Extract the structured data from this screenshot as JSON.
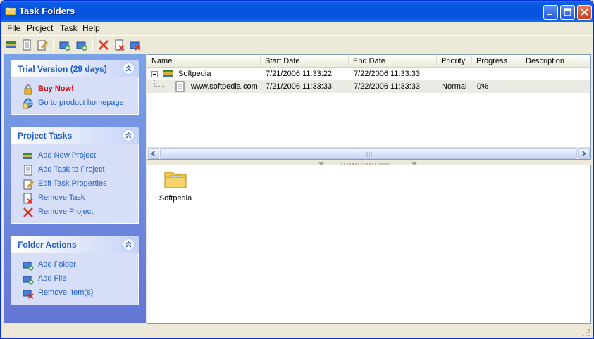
{
  "window": {
    "title": "Task Folders"
  },
  "menu": [
    "File",
    "Project",
    "Task",
    "Help"
  ],
  "taskpane": {
    "groups": [
      {
        "title": "Trial Version (29 days)",
        "items": [
          {
            "label": "Buy Now!",
            "icon": "lock-icon"
          },
          {
            "label": "Go to product homepage",
            "icon": "globe-icon"
          }
        ]
      },
      {
        "title": "Project Tasks",
        "items": [
          {
            "label": "Add New Project",
            "icon": "add-project-icon"
          },
          {
            "label": "Add Task to Project",
            "icon": "add-task-icon"
          },
          {
            "label": "Edit Task Properties",
            "icon": "edit-task-icon"
          },
          {
            "label": "Remove Task",
            "icon": "remove-task-icon"
          },
          {
            "label": "Remove Project",
            "icon": "remove-project-icon"
          }
        ]
      },
      {
        "title": "Folder Actions",
        "items": [
          {
            "label": "Add Folder",
            "icon": "add-folder-icon"
          },
          {
            "label": "Add File",
            "icon": "add-file-icon"
          },
          {
            "label": "Remove Item(s)",
            "icon": "remove-items-icon"
          }
        ]
      }
    ]
  },
  "list": {
    "columns": [
      "Name",
      "Start Date",
      "End Date",
      "Priority",
      "Progress",
      "Description"
    ],
    "rows": [
      {
        "name": "Softpedia",
        "start": "7/21/2006 11:33:22",
        "end": "7/22/2006 11:33:33",
        "priority": "",
        "progress": "",
        "description": ""
      },
      {
        "name": "www.softpedia.com",
        "start": "7/21/2006 11:33:33",
        "end": "7/22/2006 11:33:33",
        "priority": "Normal",
        "progress": "0%",
        "description": ""
      }
    ]
  },
  "iconview": {
    "items": [
      {
        "label": "Softpedia"
      }
    ]
  },
  "colors": {
    "accent": "#215dc6",
    "titlebar": "#0553e0",
    "buy": "#d40000"
  }
}
